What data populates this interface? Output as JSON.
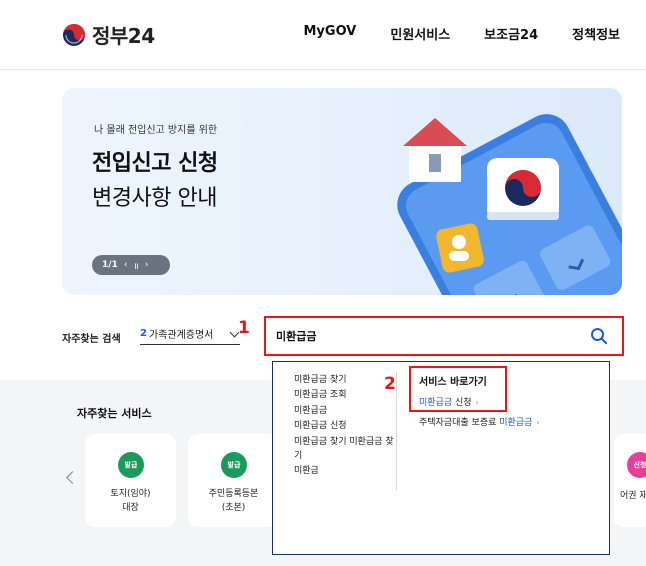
{
  "header": {
    "logo_text": "정부24",
    "nav": [
      "MyGOV",
      "민원서비스",
      "보조금24",
      "정책정보"
    ]
  },
  "banner": {
    "subtitle": "나 몰래 전입신고 방지를 위한",
    "title_line1": "전입신고 신청",
    "title_line2": "변경사항 안내",
    "pager_count": "1/1",
    "pager_prev": "‹",
    "pager_pause": "॥",
    "pager_next": "›"
  },
  "search": {
    "fav_label": "자주찾는 검색",
    "fav_rank": "2",
    "fav_value": "가족관계증명서",
    "query": "미환급금",
    "annotation_1": "1",
    "annotation_2": "2"
  },
  "autocomplete": {
    "suggestions": [
      "미환급금 찾기",
      "미환급금 조회",
      "미환급금",
      "미환급금 신청",
      "미환급금 찾기 미환급금 찾기",
      "미환금"
    ],
    "quick_title": "서비스 바로가기",
    "quick_link1_hl": "미환급금",
    "quick_link1_rest": " 신청",
    "quick_link2_prefix": "주택자금대출 보증료 ",
    "quick_link2_hl": "미환급금",
    "chevron": "›"
  },
  "services": {
    "title": "자주찾는 서비스",
    "cards": [
      {
        "badge": "발급",
        "label_line1": "토지(임야)",
        "label_line2": "대장"
      },
      {
        "badge": "발급",
        "label_line1": "주민등록등본",
        "label_line2": "(초본)"
      }
    ],
    "partial_card": {
      "badge": "신청",
      "label": "어권 재"
    }
  },
  "colors": {
    "accent_red": "#e11919",
    "link_blue": "#1d5fc9",
    "badge_green": "#1a9b5c",
    "badge_pink": "#e63e9b"
  }
}
